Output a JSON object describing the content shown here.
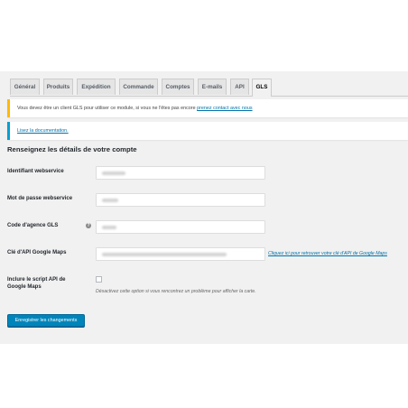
{
  "tabs": [
    {
      "label": "Général",
      "active": false
    },
    {
      "label": "Produits",
      "active": false
    },
    {
      "label": "Expédition",
      "active": false
    },
    {
      "label": "Commande",
      "active": false
    },
    {
      "label": "Comptes",
      "active": false
    },
    {
      "label": "E-mails",
      "active": false
    },
    {
      "label": "API",
      "active": false
    },
    {
      "label": "GLS",
      "active": true
    }
  ],
  "notice": {
    "text": "Vous devez être un client GLS pour utiliser ce module, si vous ne l'êtes pas encore ",
    "link": "prenez contact avec nous"
  },
  "doc_notice": {
    "link": "Lisez la documentation."
  },
  "section_title": "Renseignez les détails de votre compte",
  "fields": {
    "webservice_id": {
      "label": "Identifiant webservice"
    },
    "webservice_password": {
      "label": "Mot de passe webservice"
    },
    "agency_code": {
      "label": "Code d'agence GLS"
    },
    "google_maps_key": {
      "label": "Clé d'API Google Maps",
      "link": "Cliquez ici pour retrouver votre clé d'API de Google Maps"
    }
  },
  "include_script": {
    "label": "Inclure le script API de Google Maps",
    "checked": false,
    "description": "Désactivez cette option si vous rencontrez un problème pour afficher la carte."
  },
  "save_button": "Enregistrer les changements",
  "colors": {
    "accent": "#0085ba",
    "link": "#0073aa",
    "warning_border": "#ffb900",
    "info_border": "#00a0d2",
    "background": "#f1f1f1"
  }
}
